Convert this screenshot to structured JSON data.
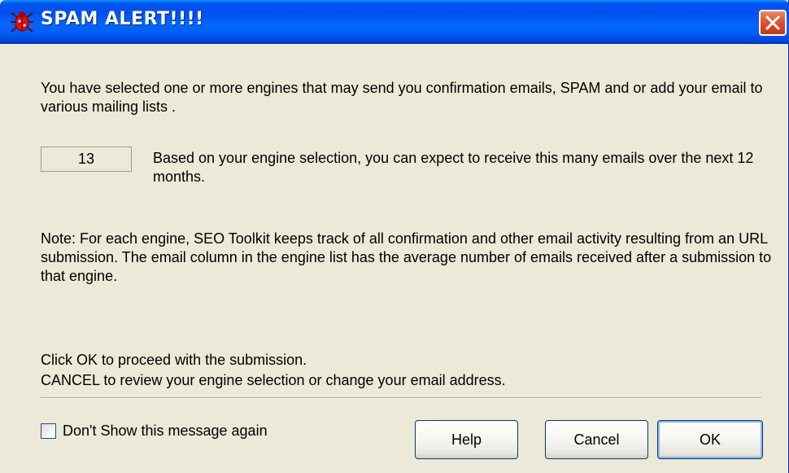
{
  "window": {
    "title": "SPAM ALERT!!!!"
  },
  "icons": {
    "app": "red-bug-icon",
    "close": "close-icon"
  },
  "body": {
    "intro": "You have selected one or more engines that may send you confirmation emails, SPAM and or add your email to various mailing lists .",
    "email_count": "13",
    "count_description": "Based on your engine selection, you can expect to receive this many emails over the next 12 months.",
    "note": "Note: For each engine, SEO Toolkit keeps track of all confirmation and other email activity resulting from an URL submission. The email column in the engine list has the average number of emails received after a submission to that engine.",
    "instruction_ok": "Click OK to proceed with the submission.",
    "instruction_cancel": "CANCEL to review your engine selection or change your email address."
  },
  "footer": {
    "dont_show_label": "Don't Show this message again",
    "dont_show_checked": false,
    "help_label": "Help",
    "cancel_label": "Cancel",
    "ok_label": "OK"
  },
  "colors": {
    "titlebar": "#0054e3",
    "dialog_bg": "#ece9d8",
    "close_button": "#e0532f",
    "button_border": "#003c74"
  }
}
